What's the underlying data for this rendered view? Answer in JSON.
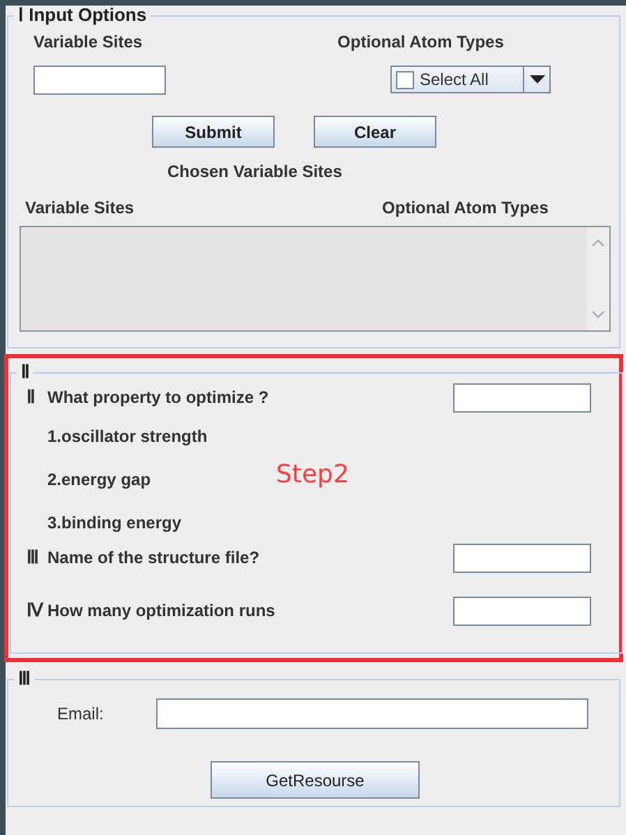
{
  "input_options": {
    "legend": "Ⅰ Input Options",
    "variable_sites_label": "Variable Sites",
    "atom_types_label": "Optional Atom Types",
    "select_all": {
      "label": "Select All",
      "checked": false
    },
    "buttons": [
      "Submit",
      "Clear"
    ],
    "chosen_title": "Chosen Variable Sites",
    "columns": [
      "Variable Sites",
      "Optional Atom Types"
    ]
  },
  "step2": {
    "annotation": "Step2",
    "legend": "Ⅱ",
    "questions": [
      {
        "numeral": "Ⅱ",
        "label": "What property to optimize ?",
        "options": [
          "1.oscillator strength",
          "2.energy gap",
          "3.binding energy"
        ]
      },
      {
        "numeral": "Ⅲ",
        "label": "Name of the structure file?"
      },
      {
        "numeral": "Ⅳ",
        "label": "How many optimization runs"
      }
    ]
  },
  "resources": {
    "legend": "Ⅲ",
    "email_label": "Email:",
    "button": "GetResourse"
  }
}
